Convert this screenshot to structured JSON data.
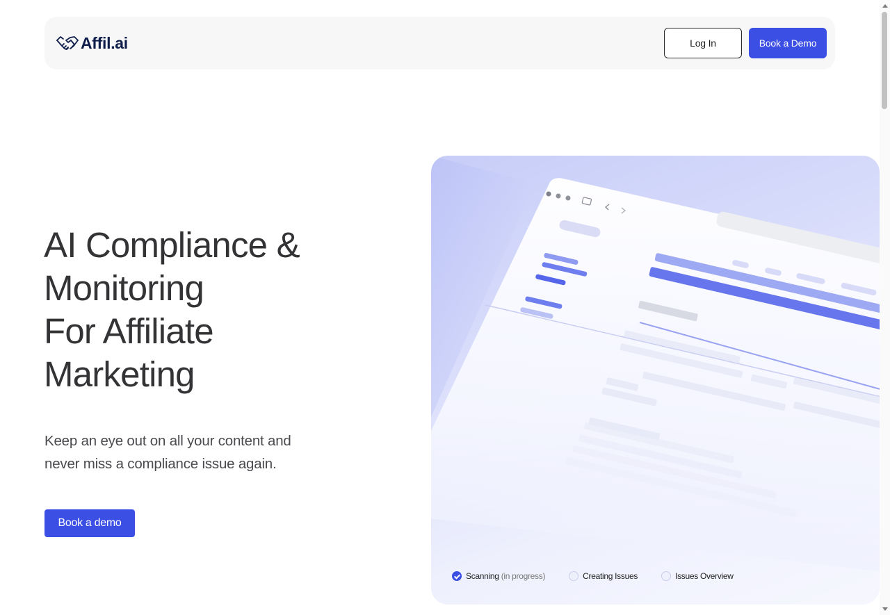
{
  "brand": {
    "name": "Affil.ai",
    "icon": "handshake-icon"
  },
  "nav": {
    "login_label": "Log In",
    "demo_label": "Book a Demo"
  },
  "hero": {
    "title_lines": [
      "AI Compliance &",
      "Monitoring",
      "For Affiliate",
      "Marketing"
    ],
    "subtitle_lines": [
      "Keep an eye out on all your content and",
      "never miss a compliance issue again."
    ],
    "cta_label": "Book a demo"
  },
  "progress_steps": [
    {
      "label": "Scanning",
      "note": "(in progress)",
      "status": "done"
    },
    {
      "label": "Creating Issues",
      "note": "",
      "status": "pending"
    },
    {
      "label": "Issues Overview",
      "note": "",
      "status": "pending"
    }
  ],
  "colors": {
    "primary": "#3b4fe4",
    "brand_text": "#0f1d4a",
    "heading": "#333336"
  }
}
